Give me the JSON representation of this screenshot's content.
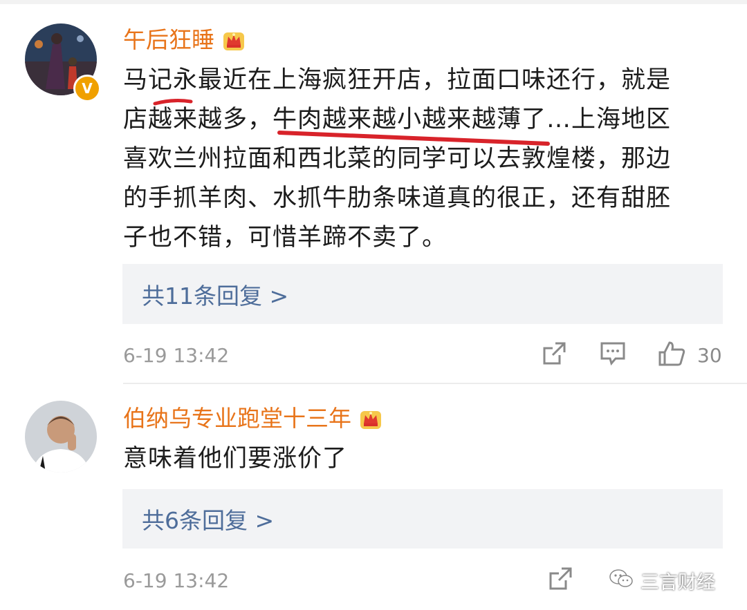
{
  "comments": [
    {
      "username": "午后狂睡",
      "content_lines": [
        "马记永最近在上海疯狂开店，拉面口味还行，就是",
        "店越来越多，牛肉越来越小越来越薄了…上海地区",
        "喜欢兰州拉面和西北菜的同学可以去敦煌楼，那边",
        "的手抓羊肉、水抓牛肋条味道真的很正，还有甜胚",
        "子也不错，可惜羊蹄不卖了。"
      ],
      "replies_label": "共11条回复 >",
      "timestamp": "6-19 13:42",
      "like_count": "30",
      "verified_mark": "V"
    },
    {
      "username": "伯纳乌专业跑堂十三年",
      "content_lines": [
        "意味着他们要涨价了"
      ],
      "replies_label": "共6条回复 >",
      "timestamp": "6-19 13:42"
    }
  ],
  "watermark": {
    "text": "三言财经"
  },
  "colors": {
    "username": "#e8741a",
    "link": "#4e6d9a",
    "underline": "#d8232a",
    "meta": "#9a9a9a",
    "reply_bg": "#f2f3f5"
  },
  "icons": {
    "share": "share-icon",
    "comment": "comment-icon",
    "like": "thumbs-up-icon",
    "member": "crown-icon",
    "watermark": "wechat-icon"
  }
}
